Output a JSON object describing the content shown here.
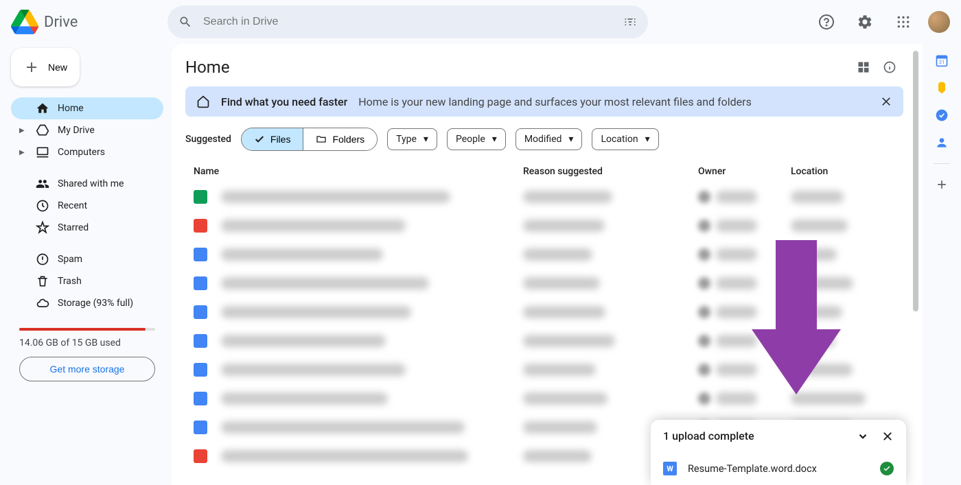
{
  "app": {
    "name": "Drive"
  },
  "search": {
    "placeholder": "Search in Drive"
  },
  "sidebar": {
    "new_label": "New",
    "items": [
      {
        "label": "Home",
        "icon": "home",
        "active": true
      },
      {
        "label": "My Drive",
        "icon": "mydrive",
        "expandable": true
      },
      {
        "label": "Computers",
        "icon": "computers",
        "expandable": true
      }
    ],
    "items2": [
      {
        "label": "Shared with me",
        "icon": "shared"
      },
      {
        "label": "Recent",
        "icon": "recent"
      },
      {
        "label": "Starred",
        "icon": "starred"
      }
    ],
    "items3": [
      {
        "label": "Spam",
        "icon": "spam"
      },
      {
        "label": "Trash",
        "icon": "trash"
      },
      {
        "label": "Storage (93% full)",
        "icon": "storage"
      }
    ],
    "storage": {
      "used_text": "14.06 GB of 15 GB used",
      "percent": 93,
      "cta": "Get more storage"
    }
  },
  "page": {
    "title": "Home",
    "banner": {
      "title": "Find what you need faster",
      "text": "Home is your new landing page and surfaces your most relevant files and folders"
    },
    "suggested_label": "Suggested",
    "segments": {
      "files": "Files",
      "folders": "Folders"
    },
    "chips": [
      "Type",
      "People",
      "Modified",
      "Location"
    ],
    "columns": {
      "name": "Name",
      "reason": "Reason suggested",
      "owner": "Owner",
      "location": "Location"
    },
    "rows": [
      {
        "icon_color": "#0f9d58"
      },
      {
        "icon_color": "#ea4335"
      },
      {
        "icon_color": "#4285f4"
      },
      {
        "icon_color": "#4285f4"
      },
      {
        "icon_color": "#4285f4"
      },
      {
        "icon_color": "#4285f4"
      },
      {
        "icon_color": "#4285f4"
      },
      {
        "icon_color": "#4285f4"
      },
      {
        "icon_color": "#4285f4"
      },
      {
        "icon_color": "#ea4335"
      }
    ]
  },
  "upload": {
    "title": "1 upload complete",
    "file": "Resume-Template.word.docx"
  }
}
